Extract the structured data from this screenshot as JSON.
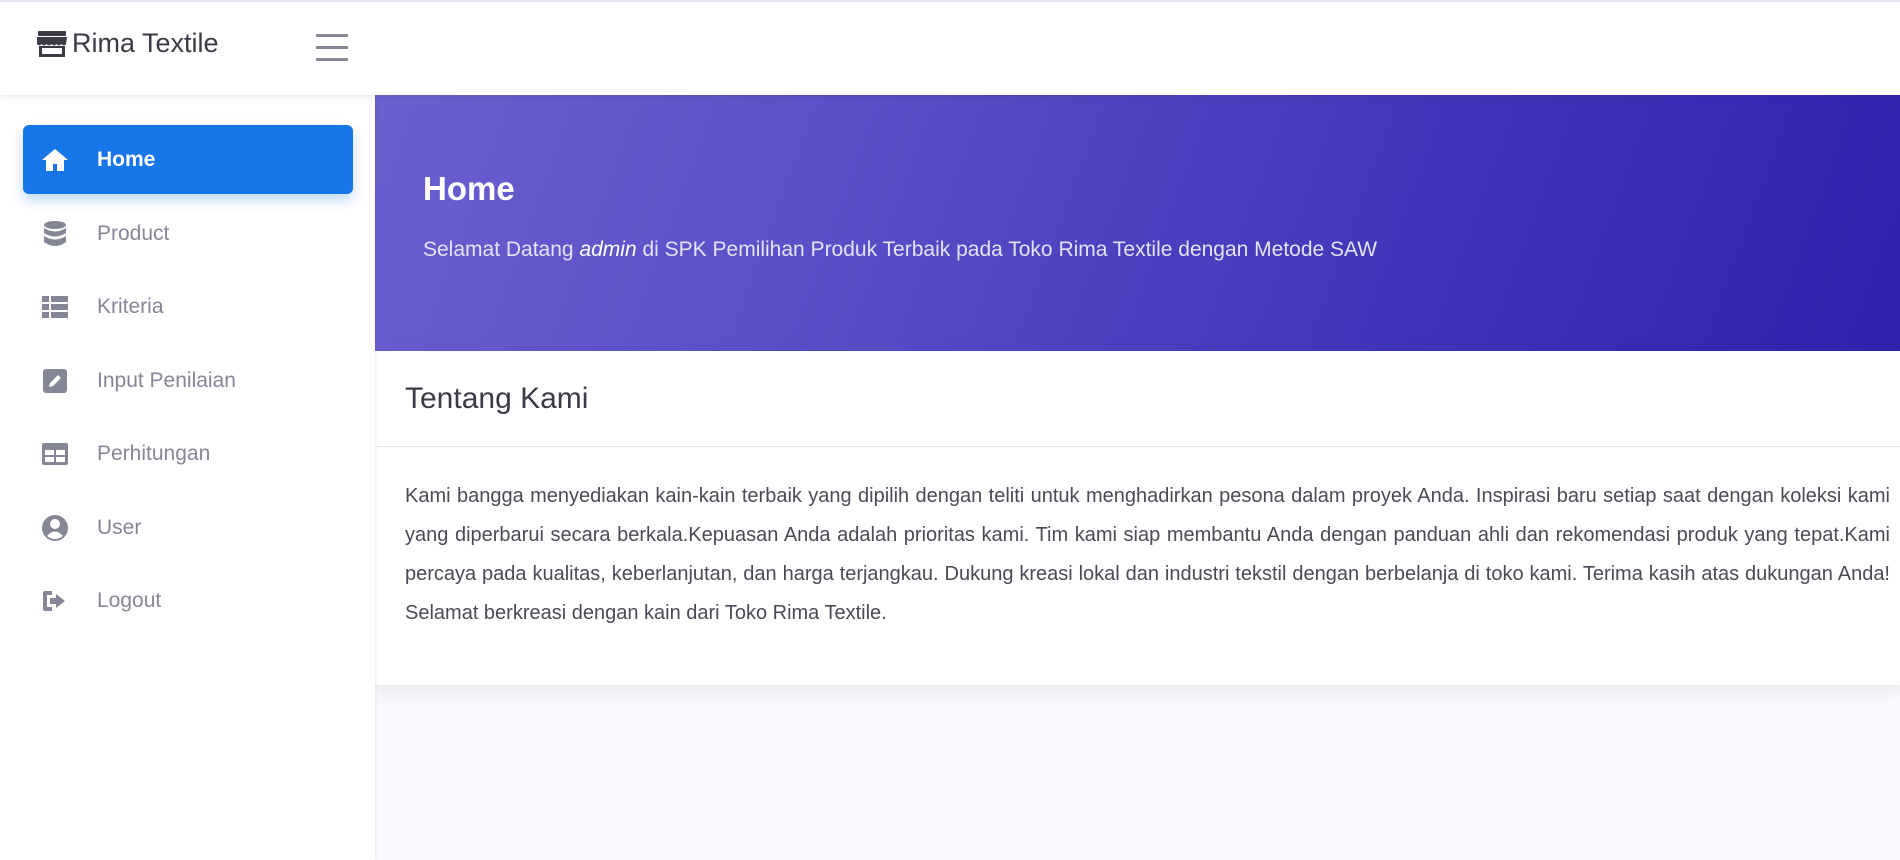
{
  "app": {
    "brand_name": "Rima Textile",
    "brand_icon": "store-icon",
    "menu_icon": "hamburger-icon"
  },
  "sidebar": {
    "items": [
      {
        "label": "Home",
        "icon": "home-icon",
        "active": true
      },
      {
        "label": "Product",
        "icon": "database-icon",
        "active": false
      },
      {
        "label": "Kriteria",
        "icon": "list-icon",
        "active": false
      },
      {
        "label": "Input Penilaian",
        "icon": "edit-icon",
        "active": false
      },
      {
        "label": "Perhitungan",
        "icon": "table-icon",
        "active": false
      },
      {
        "label": "User",
        "icon": "user-circle-icon",
        "active": false
      },
      {
        "label": "Logout",
        "icon": "sign-out-icon",
        "active": false
      }
    ]
  },
  "hero": {
    "title": "Home",
    "greeting_prefix": "Selamat Datang ",
    "username": "admin",
    "greeting_suffix": " di SPK Pemilihan Produk Terbaik pada Toko Rima Textile dengan Metode SAW"
  },
  "about": {
    "title": "Tentang Kami",
    "text": "Kami bangga menyediakan kain-kain terbaik yang dipilih dengan teliti untuk menghadirkan pesona dalam proyek Anda. Inspirasi baru setiap saat dengan koleksi kami yang diperbarui secara berkala.Kepuasan Anda adalah prioritas kami. Tim kami siap membantu Anda dengan panduan ahli dan rekomendasi produk yang tepat.Kami percaya pada kualitas, keberlanjutan, dan harga terjangkau. Dukung kreasi lokal dan industri tekstil dengan berbelanja di toko kami. Terima kasih atas dukungan Anda! Selamat berkreasi dengan kain dari Toko Rima Textile."
  },
  "colors": {
    "primary": "#1877e8",
    "hero_gradient_start": "#6a60cf",
    "hero_gradient_end": "#2f22ad",
    "sidebar_text": "#858796"
  }
}
